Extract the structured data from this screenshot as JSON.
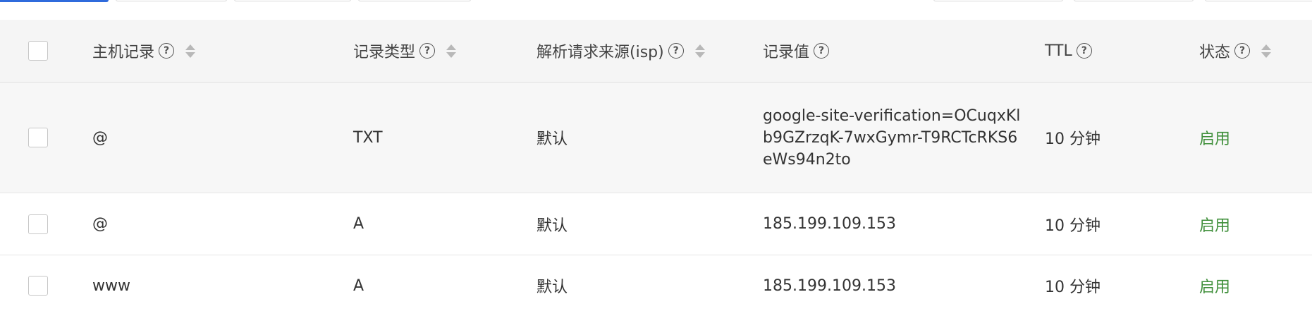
{
  "table": {
    "columns": [
      {
        "label": "主机记录",
        "help": "?",
        "sortable": true
      },
      {
        "label": "记录类型",
        "help": "?",
        "sortable": true
      },
      {
        "label": "解析请求来源(isp)",
        "help": "?",
        "sortable": true
      },
      {
        "label": "记录值",
        "help": "?",
        "sortable": false
      },
      {
        "label": "TTL",
        "help": "?",
        "sortable": false
      },
      {
        "label": "状态",
        "help": "?",
        "sortable": true
      }
    ],
    "rows": [
      {
        "host": "@",
        "type": "TXT",
        "isp": "默认",
        "value": "google-site-verification=OCuqxKlb9GZrzqK-7wxGymr-T9RCTcRKS6eWs94n2to",
        "ttl": "10 分钟",
        "status": "启用"
      },
      {
        "host": "@",
        "type": "A",
        "isp": "默认",
        "value": "185.199.109.153",
        "ttl": "10 分钟",
        "status": "启用"
      },
      {
        "host": "www",
        "type": "A",
        "isp": "默认",
        "value": "185.199.109.153",
        "ttl": "10 分钟",
        "status": "启用"
      }
    ]
  },
  "colors": {
    "status_enabled": "#3f8f3a",
    "primary": "#2f6bdc"
  }
}
